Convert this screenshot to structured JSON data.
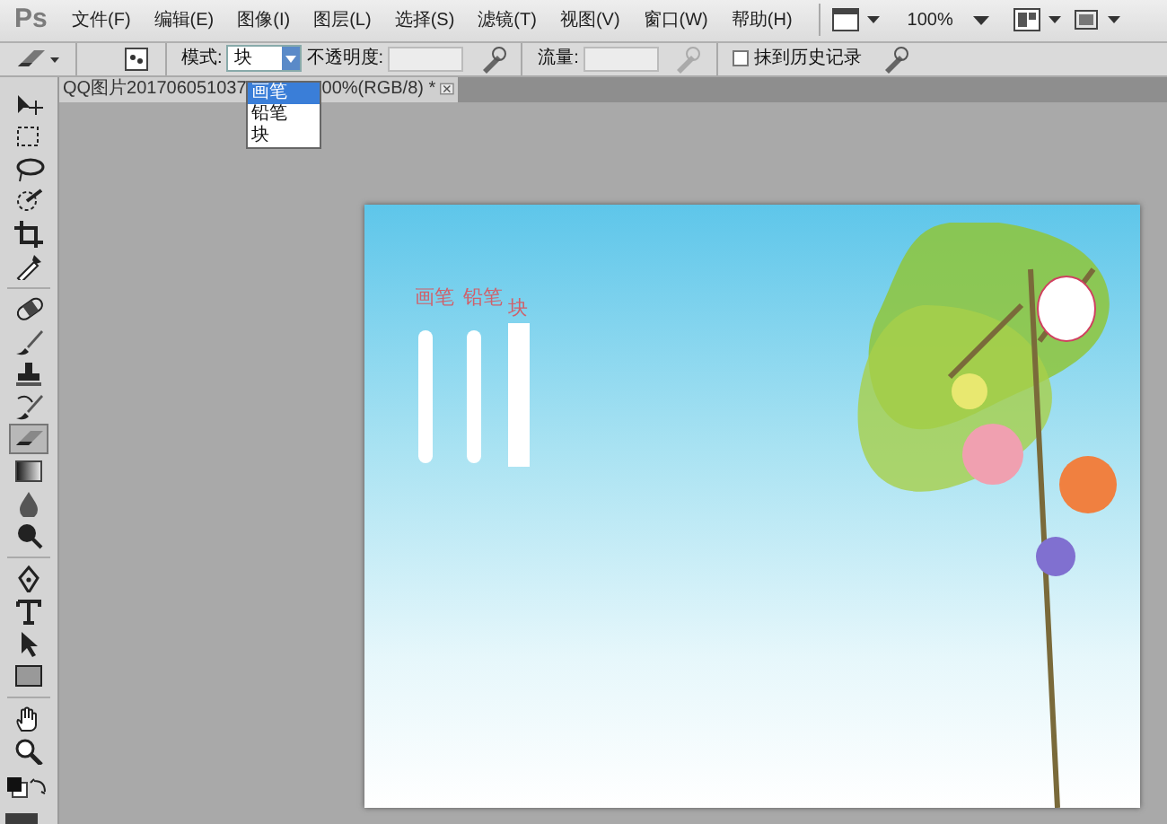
{
  "app_logo": "Ps",
  "menu": [
    {
      "label": "文件(F)"
    },
    {
      "label": "编辑(E)"
    },
    {
      "label": "图像(I)"
    },
    {
      "label": "图层(L)"
    },
    {
      "label": "选择(S)"
    },
    {
      "label": "滤镜(T)"
    },
    {
      "label": "视图(V)"
    },
    {
      "label": "窗口(W)"
    },
    {
      "label": "帮助(H)"
    }
  ],
  "zoom_level": "100%",
  "options_bar": {
    "mode_label": "模式:",
    "mode_value": "块",
    "opacity_label": "不透明度:",
    "flow_label": "流量:",
    "erase_to_history": {
      "label": "抹到历史记录",
      "checked": false
    }
  },
  "mode_dropdown": {
    "options": [
      {
        "label": "画笔",
        "selected": true
      },
      {
        "label": "铅笔",
        "selected": false
      },
      {
        "label": "块",
        "selected": false
      }
    ]
  },
  "document_tab": {
    "title_start": "QQ图片201706051037",
    "title_end": "00%(RGB/8) *"
  },
  "tool_groups": [
    [
      {
        "kind": "move",
        "selected": false
      },
      {
        "kind": "marquee",
        "selected": false
      },
      {
        "kind": "lasso",
        "selected": false
      },
      {
        "kind": "quickselect",
        "selected": false
      },
      {
        "kind": "crop",
        "selected": false
      },
      {
        "kind": "eyedropper",
        "selected": false
      }
    ],
    [
      {
        "kind": "heal",
        "selected": false
      },
      {
        "kind": "brush",
        "selected": false
      },
      {
        "kind": "stamp",
        "selected": false
      },
      {
        "kind": "historybrush",
        "selected": false
      },
      {
        "kind": "eraser",
        "selected": true
      },
      {
        "kind": "gradient",
        "selected": false
      },
      {
        "kind": "blur",
        "selected": false
      },
      {
        "kind": "dodge",
        "selected": false
      }
    ],
    [
      {
        "kind": "pen",
        "selected": false
      },
      {
        "kind": "type",
        "selected": false
      },
      {
        "kind": "pathselect",
        "selected": false
      },
      {
        "kind": "shape",
        "selected": false
      }
    ],
    [
      {
        "kind": "hand",
        "selected": false
      },
      {
        "kind": "zoom",
        "selected": false
      }
    ]
  ],
  "canvas": {
    "stroke_samples": [
      {
        "label": "画笔",
        "kind": "round"
      },
      {
        "label": "铅笔",
        "kind": "round"
      },
      {
        "label": "块",
        "kind": "square"
      }
    ]
  }
}
